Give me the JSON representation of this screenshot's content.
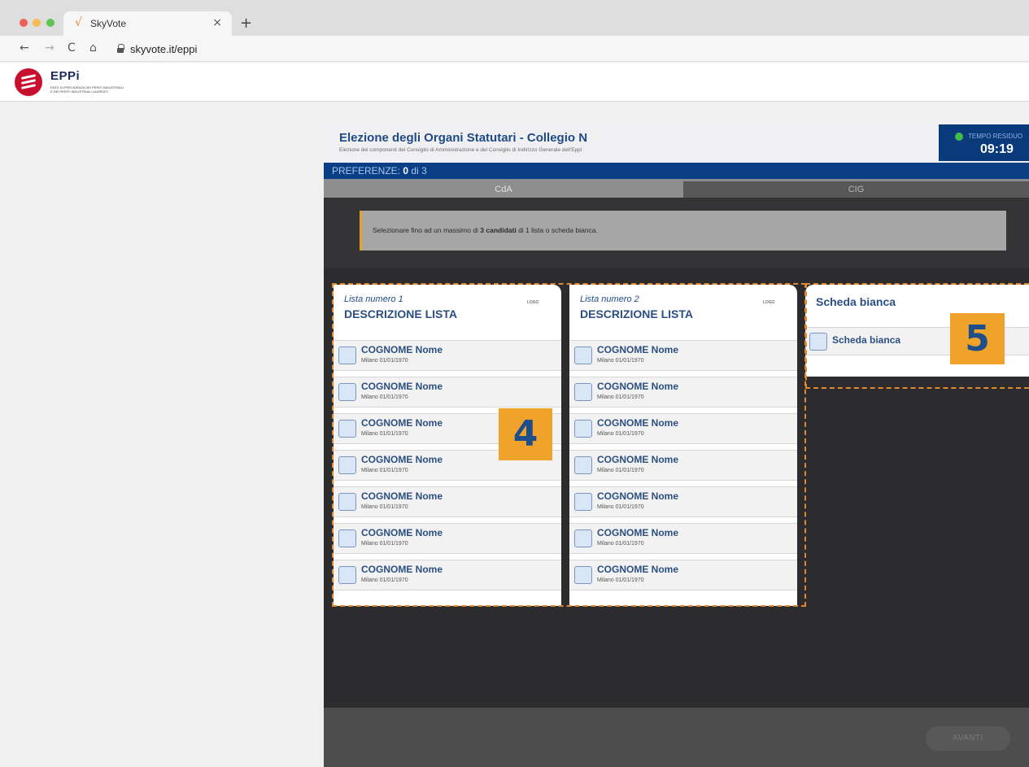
{
  "browser": {
    "tab_title": "SkyVote",
    "tab_favicon": "√",
    "tab_close": "×",
    "new_tab": "+",
    "back": "←",
    "forward": "→",
    "reload": "C",
    "home": "⌂",
    "url": "skyvote.it/eppi"
  },
  "site": {
    "logo_name": "EPPi",
    "logo_sub1": "ENTE DI PREVIDENZA DEI PERITI INDUSTRIALI",
    "logo_sub2": "E DEI PERITI INDUSTRIALI LAUREATI",
    "brand_color": "#c8102e"
  },
  "app": {
    "title": "Elezione degli Organi Statutari - Collegio N",
    "subtitle": "Elezione dei componenti del Consiglio di Amministrazione e del Consiglio di Indirizzo Generale dell'Eppi",
    "timer_label": "TEMPO RESIDUO",
    "timer_value": "09:19",
    "pref_label": "PREFERENZE:",
    "pref_count": "0",
    "pref_total": "di 3",
    "tabs": [
      {
        "label": "CdA",
        "active": true
      },
      {
        "label": "CIG",
        "active": false
      }
    ],
    "instruction": {
      "pre": "Selezionare fino ad un massimo di ",
      "bold": "3 candidati",
      "post": " di 1 lista o scheda bianca."
    },
    "lists": [
      {
        "number": "Lista numero 1",
        "description": "DESCRIZIONE LISTA",
        "logo": "LOGO",
        "candidates": [
          {
            "name": "COGNOME Nome",
            "info": "Milano 01/01/1970"
          },
          {
            "name": "COGNOME Nome",
            "info": "Milano 01/01/1970"
          },
          {
            "name": "COGNOME Nome",
            "info": "Milano 01/01/1970"
          },
          {
            "name": "COGNOME Nome",
            "info": "Milano 01/01/1970"
          },
          {
            "name": "COGNOME Nome",
            "info": "Milano 01/01/1970"
          },
          {
            "name": "COGNOME Nome",
            "info": "Milano 01/01/1970"
          },
          {
            "name": "COGNOME Nome",
            "info": "Milano 01/01/1970"
          }
        ]
      },
      {
        "number": "Lista numero 2",
        "description": "DESCRIZIONE LISTA",
        "logo": "LOGO",
        "candidates": [
          {
            "name": "COGNOME Nome",
            "info": "Milano 01/01/1970"
          },
          {
            "name": "COGNOME Nome",
            "info": "Milano 01/01/1970"
          },
          {
            "name": "COGNOME Nome",
            "info": "Milano 01/01/1970"
          },
          {
            "name": "COGNOME Nome",
            "info": "Milano 01/01/1970"
          },
          {
            "name": "COGNOME Nome",
            "info": "Milano 01/01/1970"
          },
          {
            "name": "COGNOME Nome",
            "info": "Milano 01/01/1970"
          },
          {
            "name": "COGNOME Nome",
            "info": "Milano 01/01/1970"
          }
        ]
      }
    ],
    "scheda_bianca": {
      "title": "Scheda bianca",
      "option": "Scheda bianca"
    },
    "next_button": "AVANTI"
  },
  "annotations": {
    "badge_lists": "4",
    "badge_bianca": "5"
  }
}
